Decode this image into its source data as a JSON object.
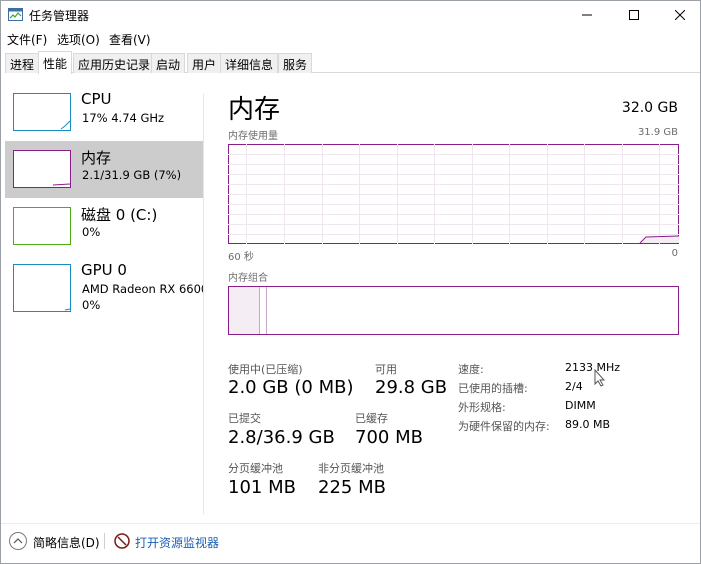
{
  "window": {
    "title": "任务管理器"
  },
  "menu": [
    "文件(F)",
    "选项(O)",
    "查看(V)"
  ],
  "tabs": [
    "进程",
    "性能",
    "应用历史记录",
    "启动",
    "用户",
    "详细信息",
    "服务"
  ],
  "active_tab": "性能",
  "resources": [
    {
      "name": "CPU",
      "sub1": "17% 4.74 GHz",
      "sub2": "",
      "color": "#1a8cc1"
    },
    {
      "name": "内存",
      "sub1": "2.1/31.9 GB (7%)",
      "sub2": "",
      "color": "#8b1d8b"
    },
    {
      "name": "磁盘 0 (C:)",
      "sub1": "0%",
      "sub2": "",
      "color": "#4caf1a"
    },
    {
      "name": "GPU 0",
      "sub1": "AMD Radeon RX 6600",
      "sub2": "0%",
      "color": "#1a8cc1"
    }
  ],
  "memory": {
    "title": "内存",
    "total": "32.0 GB",
    "usage_label": "内存使用量",
    "usage_max": "31.9 GB",
    "time_left": "60 秒",
    "time_right": "0",
    "composition_label": "内存组合",
    "stats": {
      "in_use_label": "使用中(已压缩)",
      "in_use_value": "2.0 GB (0 MB)",
      "available_label": "可用",
      "available_value": "29.8 GB",
      "committed_label": "已提交",
      "committed_value": "2.8/36.9 GB",
      "cached_label": "已缓存",
      "cached_value": "700 MB",
      "paged_label": "分页缓冲池",
      "paged_value": "101 MB",
      "nonpaged_label": "非分页缓冲池",
      "nonpaged_value": "225 MB"
    },
    "details": [
      {
        "label": "速度:",
        "value": "2133 MHz"
      },
      {
        "label": "已使用的插槽:",
        "value": "2/4"
      },
      {
        "label": "外形规格:",
        "value": "DIMM"
      },
      {
        "label": "为硬件保留的内存:",
        "value": "89.0 MB"
      }
    ]
  },
  "footer": {
    "fewer_details": "简略信息(D)",
    "open_monitor": "打开资源监视器"
  },
  "colors": {
    "memory": "#8b1d8b",
    "cpu": "#1a8cc1",
    "disk": "#4caf1a",
    "selected": "#cccccc",
    "link": "#1a5fb4"
  }
}
